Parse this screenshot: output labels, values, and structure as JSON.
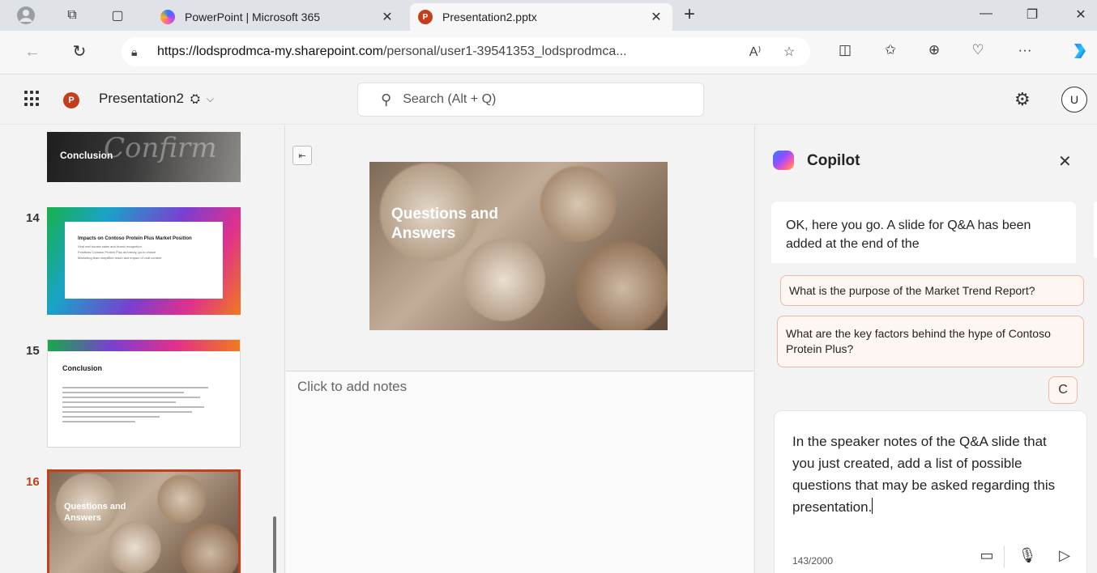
{
  "browser": {
    "tabs": [
      {
        "title": "PowerPoint | Microsoft 365",
        "favicon": "m365-icon",
        "active": false
      },
      {
        "title": "Presentation2.pptx",
        "favicon": "powerpoint-icon",
        "active": true
      }
    ],
    "new_tab": "+",
    "window_controls": {
      "minimize": "—",
      "restore": "❐",
      "close": "✕"
    },
    "url_host": "https://lodsprodmca-my.sharepoint.com",
    "url_path": "/personal/user1-39541353_lodsprodmca...",
    "read_aloud": "A⁾",
    "more": "···"
  },
  "app": {
    "logo_letter": "P",
    "doc_name": "Presentation2",
    "search_placeholder": "Search (Alt + Q)",
    "avatar_initial": "U"
  },
  "thumbnails": [
    {
      "number": "",
      "title": "Conclusion",
      "script_word": "Confirm"
    },
    {
      "number": "14",
      "title": "Impacts on Contoso Protein Plus Market Position",
      "bullets": [
        "Viral reel boosts sales and brand recognition",
        "Positions Contoso Protein Plus as trendy, go-to choice",
        "Marketing team amplifies reach and impact of viral content"
      ]
    },
    {
      "number": "15",
      "title": "Conclusion"
    },
    {
      "number": "16",
      "title": "Questions and Answers",
      "selected": true
    }
  ],
  "editor": {
    "slide_title": "Questions and Answers",
    "notes_placeholder": "Click to add notes"
  },
  "copilot": {
    "title": "Copilot",
    "response": "OK, here you go. A slide for Q&A has been added at the end of the",
    "suggestions": [
      "What is the purpose of the Market Trend Report?",
      "What are the key factors behind the hype of Contoso Protein Plus?"
    ],
    "refresh": "C",
    "prompt": "In the speaker notes of the Q&A slide that you just created, add a list of possible questions that may be asked regarding this presentation.",
    "char_count": "143/2000"
  },
  "colors": {
    "accent_powerpoint": "#c43e1c",
    "suggestion_border": "#e8b9a9",
    "background": "#f3f3f3"
  }
}
